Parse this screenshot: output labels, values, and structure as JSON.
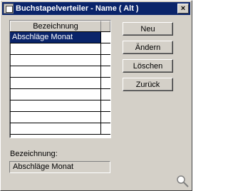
{
  "window": {
    "title": "Buchstapelverteiler - Name ( Alt )",
    "close_label": "×"
  },
  "list": {
    "header": "Bezeichnung",
    "rows": [
      "Abschläge Monat",
      "",
      "",
      "",
      "",
      "",
      "",
      "",
      ""
    ],
    "selected_index": 0
  },
  "buttons": {
    "new": "Neu",
    "edit": "Ändern",
    "delete": "Löschen",
    "back": "Zurück"
  },
  "detail": {
    "label": "Bezeichnung:",
    "value": "Abschläge Monat"
  },
  "icons": {
    "window_icon": "window-icon",
    "close_icon": "close-icon",
    "resize_grip": "zoom-icon"
  },
  "colors": {
    "titlebar": "#0a246a",
    "selection": "#0a246a",
    "face": "#d4d0c8"
  }
}
